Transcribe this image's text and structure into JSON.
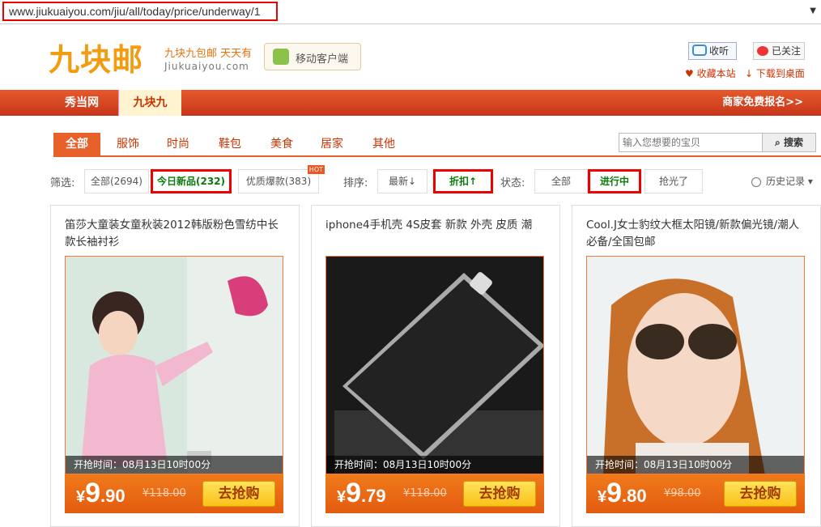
{
  "browser": {
    "url": "www.jiukuaiyou.com/jiu/all/today/price/underway/1"
  },
  "header": {
    "logo": "九块邮",
    "tagline": "九块九包邮 天天有",
    "tagline_domain": "Jiukuaiyou.com",
    "mobile_client": "移动客户端",
    "listen": "收听",
    "followed": "已关注",
    "bookmark": "收藏本站",
    "download": "下载到桌面"
  },
  "nav": {
    "items": [
      "秀当网",
      "九块九"
    ],
    "merchant": "商家免费报名>>"
  },
  "categories": [
    "全部",
    "服饰",
    "时尚",
    "鞋包",
    "美食",
    "居家",
    "其他"
  ],
  "search": {
    "placeholder": "输入您想要的宝贝",
    "button": "搜索"
  },
  "filters": {
    "filter_label": "筛选:",
    "filter_options": [
      "全部(2694)",
      "今日新品(232)",
      "优质爆款(383)"
    ],
    "hot_badge": "HOT",
    "sort_label": "排序:",
    "sort_options": [
      "最新",
      "折扣"
    ],
    "status_label": "状态:",
    "status_options": [
      "全部",
      "进行中",
      "抢光了"
    ],
    "history": "历史记录"
  },
  "products": [
    {
      "title": "笛莎大童装女童秋装2012韩版粉色雪纺中长款长袖衬衫",
      "time": "开抢时间：08月13日10时00分",
      "yen": "¥",
      "int": "9",
      "dec": ".90",
      "old": "¥118.00",
      "buy": "去抢购"
    },
    {
      "title": "iphone4手机壳 4S皮套 新款 外壳 皮质 潮",
      "time": "开抢时间：08月13日10时00分",
      "yen": "¥",
      "int": "9",
      "dec": ".79",
      "old": "¥118.00",
      "buy": "去抢购"
    },
    {
      "title": "Cool.J女士豹纹大框太阳镜/新款偏光镜/潮人必备/全国包邮",
      "time": "开抢时间：08月13日10时00分",
      "yen": "¥",
      "int": "9",
      "dec": ".80",
      "old": "¥98.00",
      "buy": "去抢购"
    }
  ]
}
